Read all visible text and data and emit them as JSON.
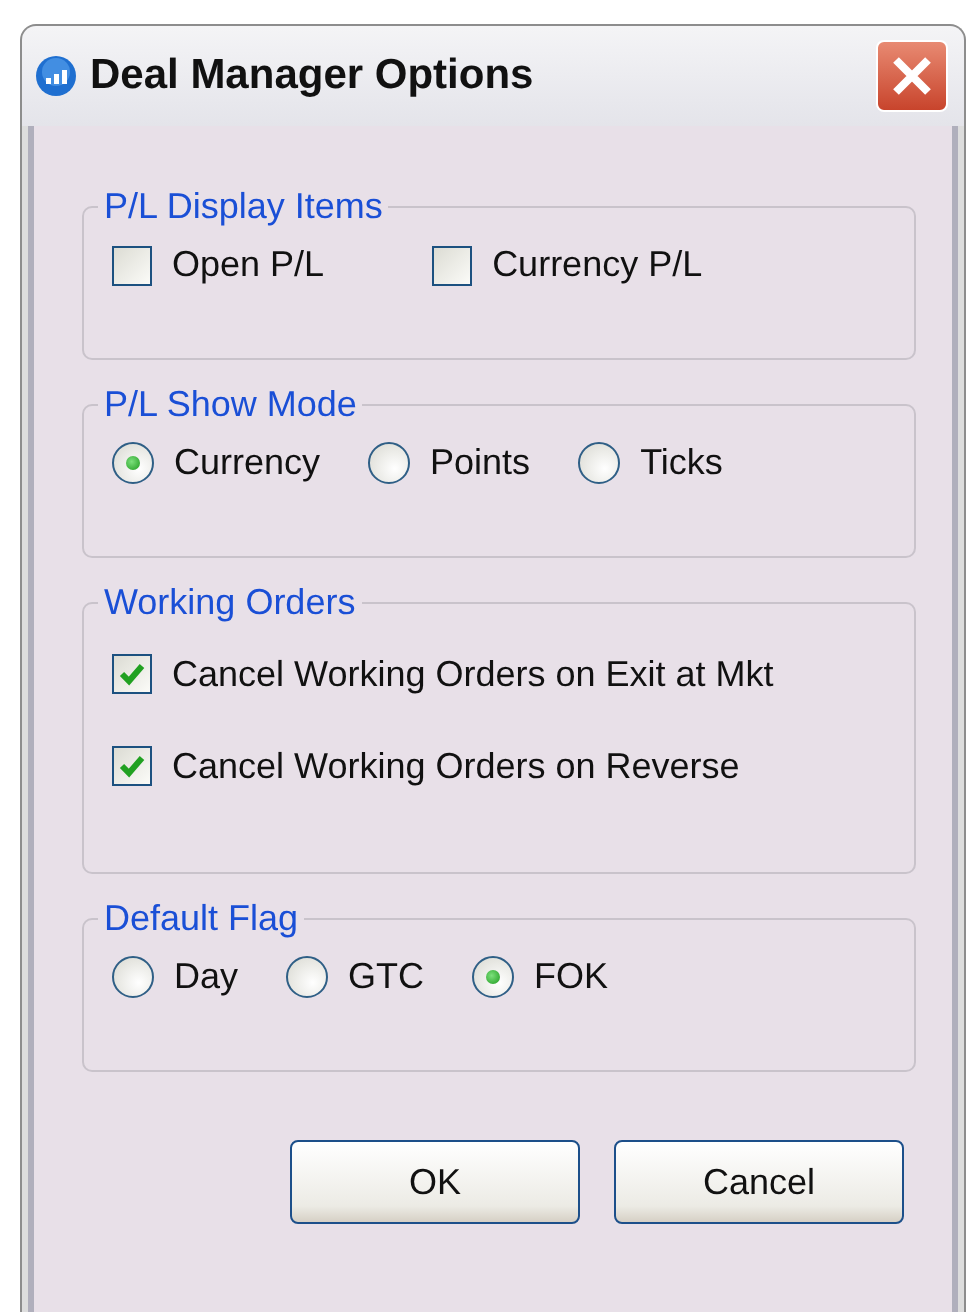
{
  "window": {
    "title": "Deal Manager Options"
  },
  "groups": [
    {
      "title": "P/L Display Items",
      "kind": "checks-row",
      "items": [
        {
          "label": "Open P/L",
          "checked": false
        },
        {
          "label": "Currency P/L",
          "checked": false
        }
      ]
    },
    {
      "title": "P/L Show Mode",
      "kind": "radios-row",
      "items": [
        {
          "label": "Currency",
          "selected": true
        },
        {
          "label": "Points",
          "selected": false
        },
        {
          "label": "Ticks",
          "selected": false
        }
      ]
    },
    {
      "title": "Working Orders",
      "kind": "checks-column",
      "items": [
        {
          "label": "Cancel Working Orders on Exit at Mkt",
          "checked": true
        },
        {
          "label": "Cancel Working Orders on Reverse",
          "checked": true
        }
      ]
    },
    {
      "title": "Default Flag",
      "kind": "radios-row",
      "items": [
        {
          "label": "Day",
          "selected": false
        },
        {
          "label": "GTC",
          "selected": false
        },
        {
          "label": "FOK",
          "selected": true
        }
      ]
    }
  ],
  "buttons": [
    {
      "label": "OK"
    },
    {
      "label": "Cancel"
    }
  ]
}
